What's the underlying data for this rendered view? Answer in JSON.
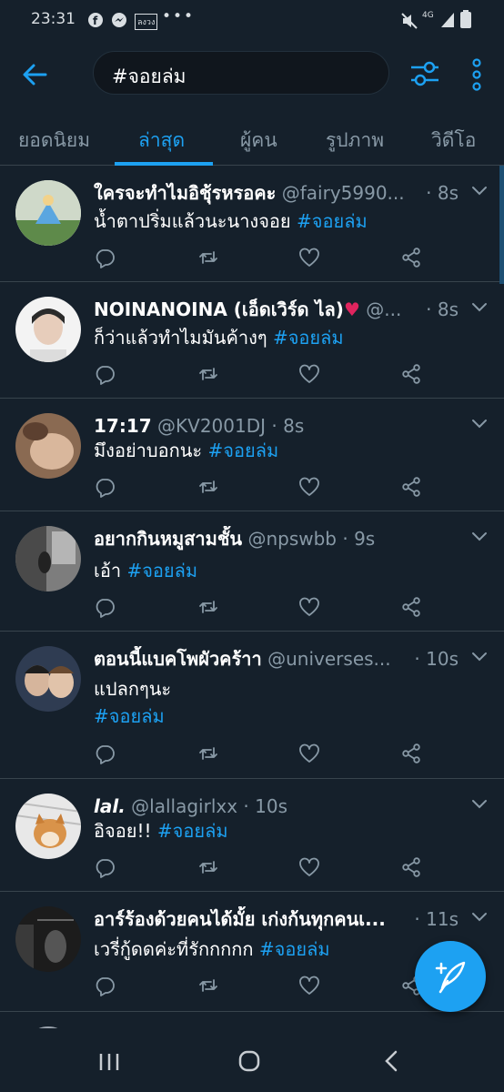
{
  "status": {
    "time": "23:31",
    "net": "4G",
    "notif": "ลงวง"
  },
  "search": {
    "query": "#จอยล่ม"
  },
  "tabs": [
    {
      "label": "ยอดนิยม"
    },
    {
      "label": "ล่าสุด"
    },
    {
      "label": "ผู้คน"
    },
    {
      "label": "รูปภาพ"
    },
    {
      "label": "วิดีโอ"
    }
  ],
  "tweets": [
    {
      "name": "ใครจะทำไมอิชุ้รหรอคะ",
      "handle": "@fairy5990...",
      "time": "· 8s",
      "lines": [
        "น้ำตาปริ่มแล้วนะนางจอย "
      ],
      "hashtag": "#จอยล่ม"
    },
    {
      "name": "NOINANOINA (เอ็ดเวิร์ด ไล)",
      "handle": "@...",
      "time": "· 8s",
      "lines": [
        "ก็ว่าแล้วทำไมมันค้างๆ  "
      ],
      "hashtag": "#จอยล่ม"
    },
    {
      "name": "17:17",
      "handle": "@KV2001DJ · 8s",
      "time": "",
      "lines": [
        "มึงอย่าบอกนะ "
      ],
      "hashtag": "#จอยล่ม"
    },
    {
      "name": "อยากกินหมูสามชั้น",
      "handle": "@npswbb · 9s",
      "time": "",
      "lines": [
        "เอ้า "
      ],
      "hashtag": "#จอยล่ม"
    },
    {
      "name": "ตอนนี้แบคโพผัวคร้าา",
      "handle": "@universes...",
      "time": "· 10s",
      "lines": [
        "แปลกๆนะ"
      ],
      "hashtag": "#จอยล่ม"
    },
    {
      "name": "lal.",
      "handle": "@lallagirlxx · 10s",
      "time": "",
      "lines": [
        "อิจอย!! "
      ],
      "hashtag": "#จอยล่ม"
    },
    {
      "name": "อาร์ร้องด้วยคนได้มั้ย เก่งก้นทุกคนเ...",
      "handle": "",
      "time": "· 11s",
      "lines": [
        "เวรี่กู้ดดค่ะที่รักกกกก "
      ],
      "hashtag": "#จอยล่ม"
    }
  ],
  "colors": {
    "bg": "#15202b",
    "accent": "#1da1f2",
    "muted": "#8899a6",
    "divider": "#38444d"
  },
  "icons": [
    "back-arrow-icon",
    "filter-icon",
    "more-vert-icon",
    "reply-icon",
    "retweet-icon",
    "like-icon",
    "share-icon",
    "chevron-down-icon",
    "compose-icon"
  ]
}
